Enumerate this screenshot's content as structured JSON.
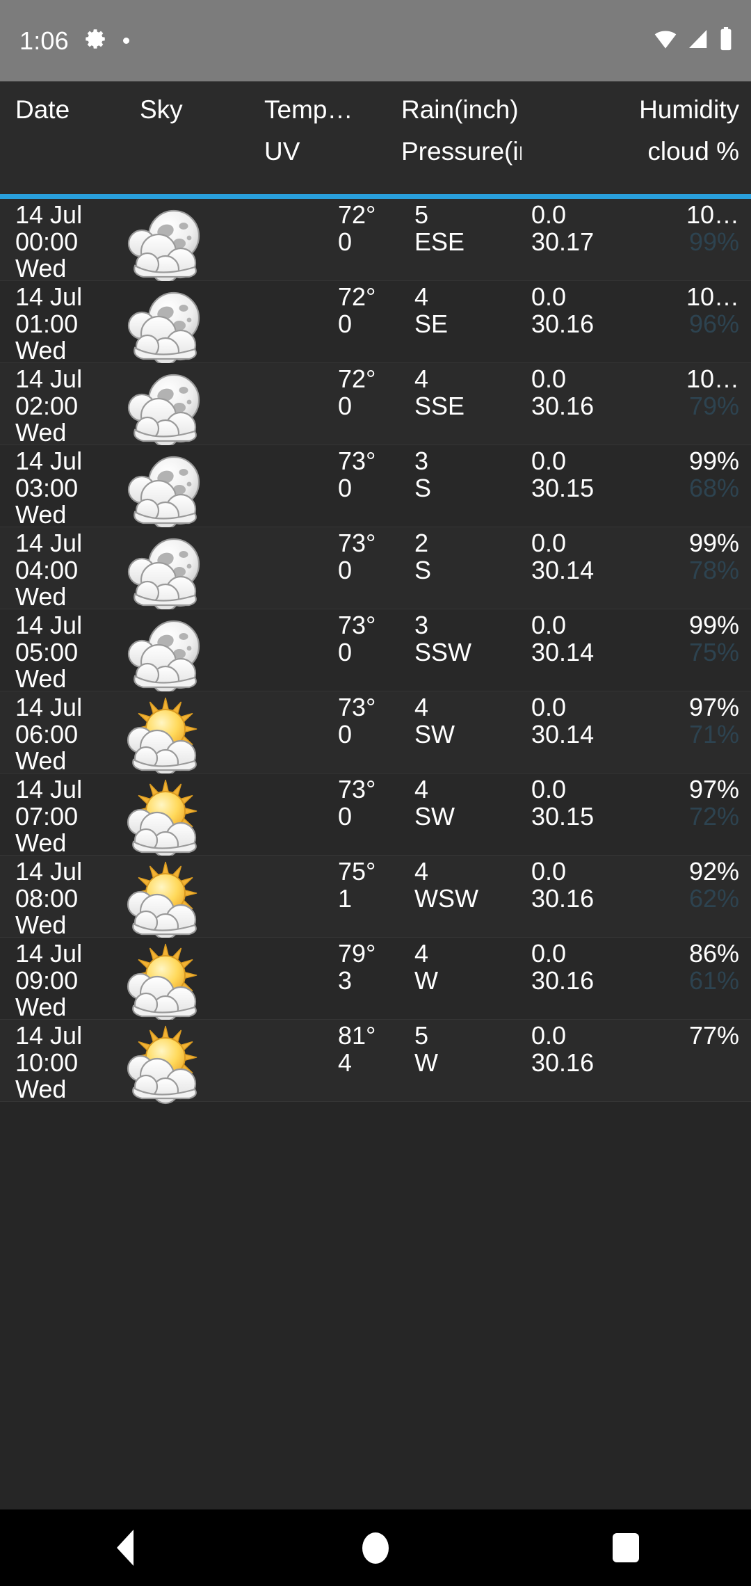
{
  "status_bar": {
    "clock": "1:06",
    "icons": [
      "gear-icon",
      "dot-icon",
      "wifi-icon",
      "cellular-signal-icon",
      "battery-icon"
    ]
  },
  "header": {
    "row1": [
      "Date",
      "Sky",
      "Temp…",
      "Rain(inch)",
      "",
      "Humidity"
    ],
    "row2": [
      "",
      "",
      "UV",
      "Pressure(in…",
      "",
      "cloud %"
    ],
    "labels": {
      "date": "Date",
      "sky": "Sky",
      "temp": "Temp…",
      "uv": "UV",
      "rain": "Rain(inch)",
      "pressure": "Pressure(in…",
      "humidity": "Humidity",
      "cloud": "cloud %"
    }
  },
  "colors": {
    "accent": "#29a0dd",
    "status_bar_bg": "#7c7c7c",
    "list_bg": "#2b2b2b",
    "text": "#ffffff",
    "cloud_text": "#2d4350"
  },
  "rows": [
    {
      "date": "14 Jul",
      "time": "00:00",
      "day": "Wed",
      "sky": "moon-cloud-icon",
      "temp": "72°",
      "uv": "0",
      "wind": "5",
      "dir": "ESE",
      "rain": "0.0",
      "pressure": "30.17",
      "humidity": "10…",
      "cloud": "99%"
    },
    {
      "date": "14 Jul",
      "time": "01:00",
      "day": "Wed",
      "sky": "moon-cloud-icon",
      "temp": "72°",
      "uv": "0",
      "wind": "4",
      "dir": "SE",
      "rain": "0.0",
      "pressure": "30.16",
      "humidity": "10…",
      "cloud": "96%"
    },
    {
      "date": "14 Jul",
      "time": "02:00",
      "day": "Wed",
      "sky": "moon-cloud-icon",
      "temp": "72°",
      "uv": "0",
      "wind": "4",
      "dir": "SSE",
      "rain": "0.0",
      "pressure": "30.16",
      "humidity": "10…",
      "cloud": "79%"
    },
    {
      "date": "14 Jul",
      "time": "03:00",
      "day": "Wed",
      "sky": "moon-cloud-icon",
      "temp": "73°",
      "uv": "0",
      "wind": "3",
      "dir": "S",
      "rain": "0.0",
      "pressure": "30.15",
      "humidity": "99%",
      "cloud": "68%"
    },
    {
      "date": "14 Jul",
      "time": "04:00",
      "day": "Wed",
      "sky": "moon-cloud-icon",
      "temp": "73°",
      "uv": "0",
      "wind": "2",
      "dir": "S",
      "rain": "0.0",
      "pressure": "30.14",
      "humidity": "99%",
      "cloud": "78%"
    },
    {
      "date": "14 Jul",
      "time": "05:00",
      "day": "Wed",
      "sky": "moon-cloud-icon",
      "temp": "73°",
      "uv": "0",
      "wind": "3",
      "dir": "SSW",
      "rain": "0.0",
      "pressure": "30.14",
      "humidity": "99%",
      "cloud": "75%"
    },
    {
      "date": "14 Jul",
      "time": "06:00",
      "day": "Wed",
      "sky": "sun-cloud-icon",
      "temp": "73°",
      "uv": "0",
      "wind": "4",
      "dir": "SW",
      "rain": "0.0",
      "pressure": "30.14",
      "humidity": "97%",
      "cloud": "71%"
    },
    {
      "date": "14 Jul",
      "time": "07:00",
      "day": "Wed",
      "sky": "sun-cloud-icon",
      "temp": "73°",
      "uv": "0",
      "wind": "4",
      "dir": "SW",
      "rain": "0.0",
      "pressure": "30.15",
      "humidity": "97%",
      "cloud": "72%"
    },
    {
      "date": "14 Jul",
      "time": "08:00",
      "day": "Wed",
      "sky": "sun-cloud-icon",
      "temp": "75°",
      "uv": "1",
      "wind": "4",
      "dir": "WSW",
      "rain": "0.0",
      "pressure": "30.16",
      "humidity": "92%",
      "cloud": "62%"
    },
    {
      "date": "14 Jul",
      "time": "09:00",
      "day": "Wed",
      "sky": "sun-cloud-icon",
      "temp": "79°",
      "uv": "3",
      "wind": "4",
      "dir": "W",
      "rain": "0.0",
      "pressure": "30.16",
      "humidity": "86%",
      "cloud": "61%"
    },
    {
      "date": "14 Jul",
      "time": "10:00",
      "day": "Wed",
      "sky": "sun-cloud-icon",
      "temp": "81°",
      "uv": "4",
      "wind": "5",
      "dir": "W",
      "rain": "0.0",
      "pressure": "30.16",
      "humidity": "77%",
      "cloud": ""
    }
  ],
  "nav_bar": {
    "back": "back-triangle-icon",
    "home": "home-circle-icon",
    "recents": "recents-square-icon"
  }
}
